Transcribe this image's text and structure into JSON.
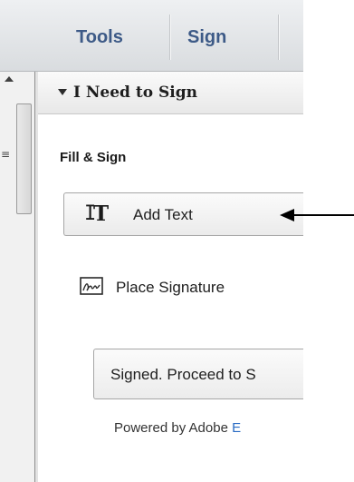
{
  "toolbar": {
    "tabs": [
      {
        "label": "Tools"
      },
      {
        "label": "Sign"
      }
    ]
  },
  "panel": {
    "title": "I Need to Sign",
    "section_label": "Fill & Sign",
    "add_text_label": "Add Text",
    "place_signature_label": "Place Signature",
    "signed_button_label": "Signed. Proceed to S",
    "powered_by_text": "Powered by Adobe",
    "powered_by_link": "E"
  },
  "icons": {
    "add_text": "text-cursor-T-icon",
    "place_signature": "signature-icon",
    "collapse": "triangle-down-icon",
    "scroll_up": "triangle-up-icon",
    "thumb_grip": "grip-lines-icon"
  },
  "colors": {
    "tab_text": "#3d5a87",
    "link": "#2b6cc4",
    "annotation_arrow": "#000000"
  }
}
